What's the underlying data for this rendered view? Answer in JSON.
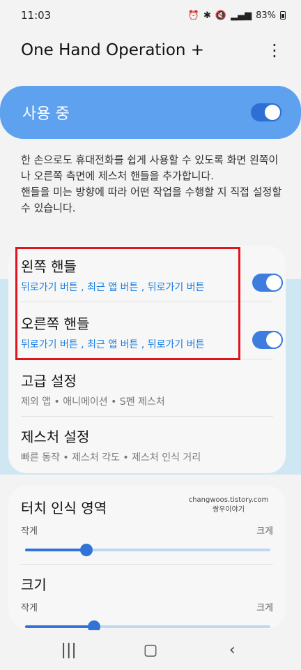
{
  "status": {
    "time": "11:03",
    "battery": "83%"
  },
  "appbar": {
    "title": "One Hand Operation +",
    "more_icon": "more-vert-icon"
  },
  "master": {
    "label": "사용 중",
    "enabled": true
  },
  "description": {
    "line1": "한 손으로도 휴대전화를 쉽게 사용할 수 있도록 화면 왼쪽이나 오른쪽 측면에 제스처 핸들을 추가합니다.",
    "line2": "핸들을 미는 방향에 따라 어떤 작업을 수행할 지 직접 설정할 수 있습니다."
  },
  "settings": {
    "left_handle": {
      "title": "왼쪽 핸들",
      "summary": "뒤로가기 버튼 , 최근 앱 버튼 , 뒤로가기 버튼",
      "enabled": true
    },
    "right_handle": {
      "title": "오른쪽 핸들",
      "summary": "뒤로가기 버튼 , 최근 앱 버튼 , 뒤로가기 버튼",
      "enabled": true
    },
    "advanced": {
      "title": "고급 설정",
      "summary": "제외 앱 • 애니메이션 • S펜 제스처"
    },
    "gesture": {
      "title": "제스처 설정",
      "summary": "빠른 동작 • 제스처 각도 • 제스처 인식 거리"
    }
  },
  "sliders": {
    "touch_area": {
      "title": "터치 인식 영역",
      "min_label": "작게",
      "max_label": "크게",
      "value": 0.25
    },
    "size": {
      "title": "크기",
      "min_label": "작게",
      "max_label": "크게",
      "value": 0.28
    }
  },
  "watermark": {
    "line1": "changwoos.tistory.com",
    "line2": "쌍우이야기"
  },
  "colors": {
    "accent": "#3e7de0",
    "master_bg": "#5ea1ee",
    "highlight": "#e0141e",
    "summary_blue": "#1a7fe0"
  }
}
